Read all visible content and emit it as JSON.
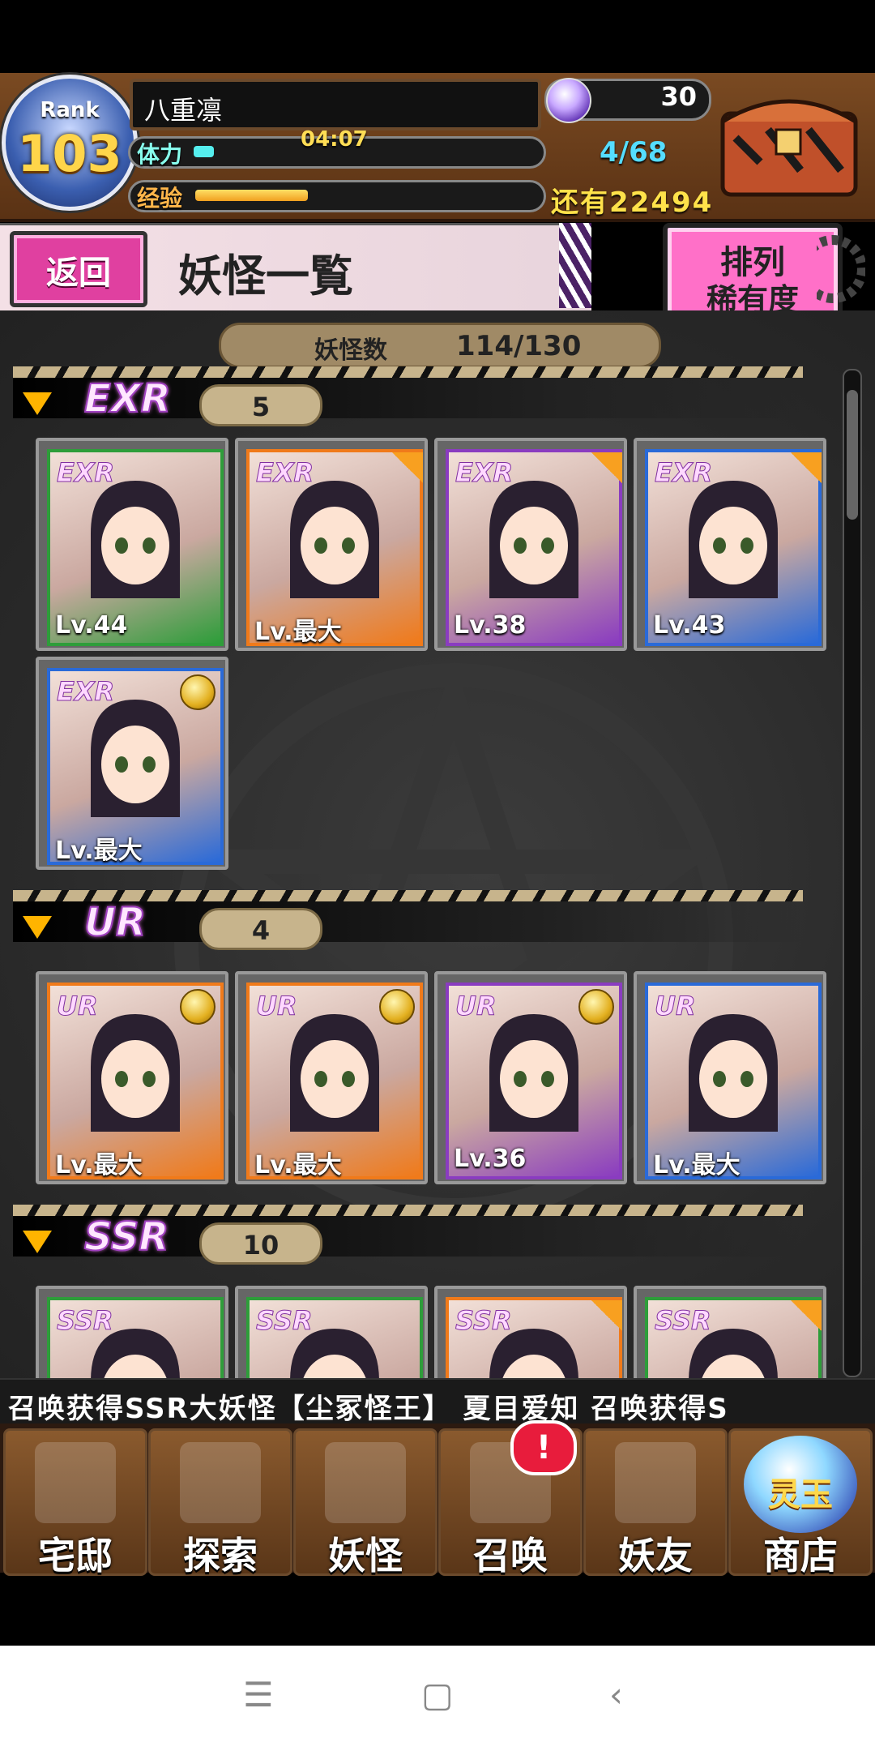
{
  "header": {
    "rank_label": "Rank",
    "rank_value": "103",
    "player_name": "八重凛",
    "stamina_label": "体力",
    "stamina_timer": "04:07",
    "stamina_fraction": 0.06,
    "exp_label": "经验",
    "exp_fraction": 0.33,
    "orb_value": "30",
    "slot_value": "4/68",
    "remain_label": "还有22494"
  },
  "titlebar": {
    "back_label": "返回",
    "title": "妖怪一覧",
    "sort_line1": "排列",
    "sort_line2": "稀有度"
  },
  "count": {
    "label": "妖怪数",
    "value": "114/130"
  },
  "sections": [
    {
      "label": "EXR",
      "count": "5",
      "cards": [
        {
          "badge": "EXR",
          "level": "Lv.44",
          "frame": "#2e9d3a",
          "mark": "none"
        },
        {
          "badge": "EXR",
          "level": "Lv.最大",
          "frame": "#f07a1a",
          "mark": "star"
        },
        {
          "badge": "EXR",
          "level": "Lv.38",
          "frame": "#8a3cc0",
          "mark": "star"
        },
        {
          "badge": "EXR",
          "level": "Lv.43",
          "frame": "#2a6ad8",
          "mark": "star"
        },
        {
          "badge": "EXR",
          "level": "Lv.最大",
          "frame": "#2a6ad8",
          "mark": "medal"
        }
      ]
    },
    {
      "label": "UR",
      "count": "4",
      "cards": [
        {
          "badge": "UR",
          "level": "Lv.最大",
          "frame": "#f07a1a",
          "mark": "medal"
        },
        {
          "badge": "UR",
          "level": "Lv.最大",
          "frame": "#f07a1a",
          "mark": "medal"
        },
        {
          "badge": "UR",
          "level": "Lv.36",
          "frame": "#8a3cc0",
          "mark": "medal"
        },
        {
          "badge": "UR",
          "level": "Lv.最大",
          "frame": "#2a6ad8",
          "mark": "none"
        }
      ]
    },
    {
      "label": "SSR",
      "count": "10",
      "cards": [
        {
          "badge": "SSR",
          "level": "",
          "frame": "#2e9d3a",
          "mark": "none"
        },
        {
          "badge": "SSR",
          "level": "",
          "frame": "#2e9d3a",
          "mark": "none"
        },
        {
          "badge": "SSR",
          "level": "",
          "frame": "#f07a1a",
          "mark": "star"
        },
        {
          "badge": "SSR",
          "level": "",
          "frame": "#2e9d3a",
          "mark": "star"
        }
      ]
    }
  ],
  "ticker": "召唤获得SSR大妖怪【尘冢怪王】    夏目爱知 召唤获得S",
  "nav": [
    {
      "label": "宅邸",
      "icon": "mansion-icon"
    },
    {
      "label": "探索",
      "icon": "magnifier-icon"
    },
    {
      "label": "妖怪",
      "icon": "scroll-icon"
    },
    {
      "label": "召唤",
      "icon": "pentagram-icon"
    },
    {
      "label": "妖友",
      "icon": "friend-icon"
    },
    {
      "label": "商店",
      "icon": "orb-icon"
    }
  ],
  "shop_orb_text": "灵玉",
  "alert": "!",
  "system_nav": [
    "menu-icon",
    "home-icon",
    "back-icon"
  ]
}
